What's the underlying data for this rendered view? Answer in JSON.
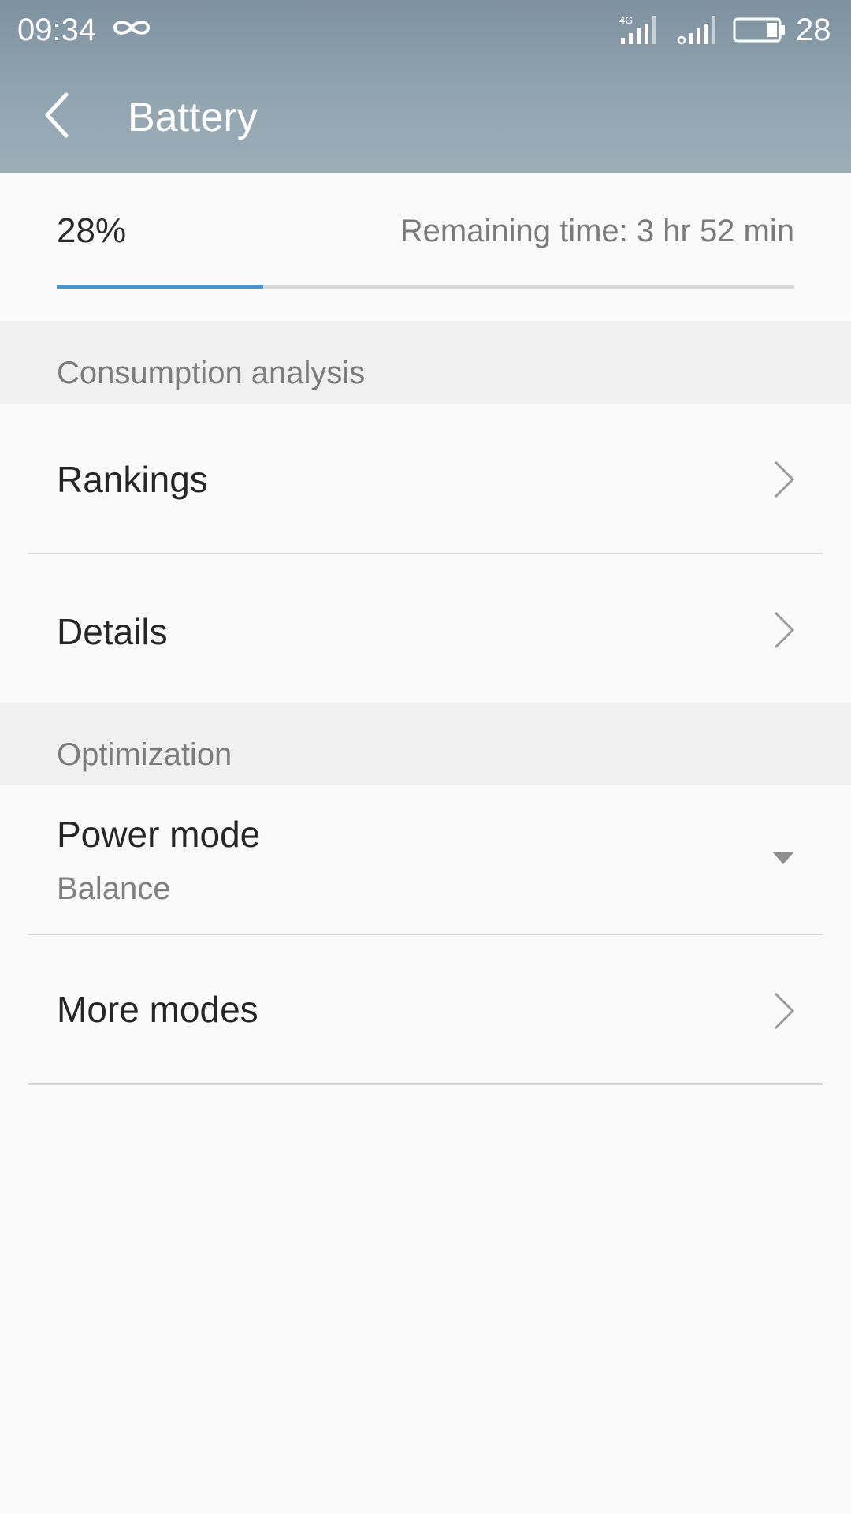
{
  "status_bar": {
    "time": "09:34",
    "battery_text": "28",
    "network_label": "4G",
    "icons": [
      "infinity-icon",
      "signal-4g-icon",
      "signal-icon",
      "battery-icon"
    ]
  },
  "header": {
    "title": "Battery",
    "back_icon": "chevron-left-icon"
  },
  "battery": {
    "percent_label": "28%",
    "level_fraction": 0.28,
    "remaining_label": "Remaining time: 3 hr 52 min",
    "progress_color": "#3d96d7"
  },
  "sections": {
    "consumption": {
      "title": "Consumption analysis",
      "items": [
        {
          "label": "Rankings"
        },
        {
          "label": "Details"
        }
      ]
    },
    "optimization": {
      "title": "Optimization",
      "power_mode": {
        "label": "Power mode",
        "value": "Balance"
      },
      "more_modes": {
        "label": "More modes"
      }
    }
  },
  "colors": {
    "header_gradient_top": "#7e91a0",
    "header_gradient_bottom": "#9cadb7",
    "background": "#fafafa",
    "section_background": "#f0f0f0"
  }
}
